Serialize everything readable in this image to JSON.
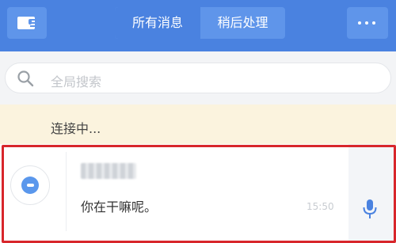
{
  "header": {
    "tabs": [
      {
        "label": "所有消息",
        "active": true
      },
      {
        "label": "稍后处理",
        "active": false
      }
    ],
    "left_icon": "sheet-mic-icon",
    "right_icon": "more-dots-icon"
  },
  "search": {
    "placeholder": "全局搜索",
    "icon": "search-icon"
  },
  "status": {
    "text": "连接中..."
  },
  "conversations": [
    {
      "name": "",
      "preview": "你在干嘛呢。",
      "time": "15:50",
      "icon": "chat-bubble-icon",
      "action_icon": "microphone-icon"
    }
  ],
  "colors": {
    "accent": "#4a82e0",
    "tab_bg": "#5f95ea",
    "highlight": "#d8262b",
    "banner": "#fbf3de"
  }
}
